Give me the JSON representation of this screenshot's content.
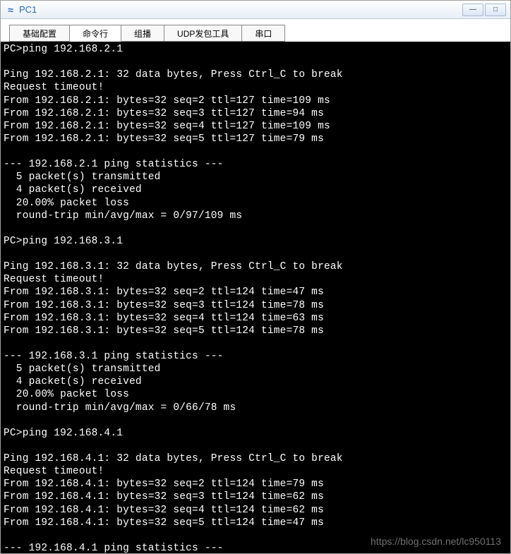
{
  "window": {
    "title": "PC1",
    "icon_glyph": "≈"
  },
  "tabs": [
    {
      "label": "基础配置",
      "active": false
    },
    {
      "label": "命令行",
      "active": true
    },
    {
      "label": "组播",
      "active": false
    },
    {
      "label": "UDP发包工具",
      "active": false
    },
    {
      "label": "串口",
      "active": false
    }
  ],
  "terminal_lines": [
    "PC>ping 192.168.2.1",
    "",
    "Ping 192.168.2.1: 32 data bytes, Press Ctrl_C to break",
    "Request timeout!",
    "From 192.168.2.1: bytes=32 seq=2 ttl=127 time=109 ms",
    "From 192.168.2.1: bytes=32 seq=3 ttl=127 time=94 ms",
    "From 192.168.2.1: bytes=32 seq=4 ttl=127 time=109 ms",
    "From 192.168.2.1: bytes=32 seq=5 ttl=127 time=79 ms",
    "",
    "--- 192.168.2.1 ping statistics ---",
    "  5 packet(s) transmitted",
    "  4 packet(s) received",
    "  20.00% packet loss",
    "  round-trip min/avg/max = 0/97/109 ms",
    "",
    "PC>ping 192.168.3.1",
    "",
    "Ping 192.168.3.1: 32 data bytes, Press Ctrl_C to break",
    "Request timeout!",
    "From 192.168.3.1: bytes=32 seq=2 ttl=124 time=47 ms",
    "From 192.168.3.1: bytes=32 seq=3 ttl=124 time=78 ms",
    "From 192.168.3.1: bytes=32 seq=4 ttl=124 time=63 ms",
    "From 192.168.3.1: bytes=32 seq=5 ttl=124 time=78 ms",
    "",
    "--- 192.168.3.1 ping statistics ---",
    "  5 packet(s) transmitted",
    "  4 packet(s) received",
    "  20.00% packet loss",
    "  round-trip min/avg/max = 0/66/78 ms",
    "",
    "PC>ping 192.168.4.1",
    "",
    "Ping 192.168.4.1: 32 data bytes, Press Ctrl_C to break",
    "Request timeout!",
    "From 192.168.4.1: bytes=32 seq=2 ttl=124 time=79 ms",
    "From 192.168.4.1: bytes=32 seq=3 ttl=124 time=62 ms",
    "From 192.168.4.1: bytes=32 seq=4 ttl=124 time=62 ms",
    "From 192.168.4.1: bytes=32 seq=5 ttl=124 time=47 ms",
    "",
    "--- 192.168.4.1 ping statistics ---",
    "  5 packet(s) transmitted",
    "  4 packet(s) received",
    "  20.00% packet loss"
  ],
  "watermark": "https://blog.csdn.net/lc950113"
}
